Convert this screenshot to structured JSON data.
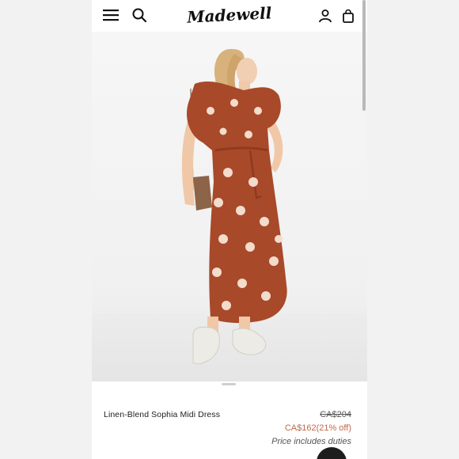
{
  "brand": {
    "logo_text": "Madewell"
  },
  "header": {
    "menu_icon": "hamburger-menu-icon",
    "search_icon": "search-icon",
    "account_icon": "account-icon",
    "bag_icon": "shopping-bag-icon"
  },
  "product": {
    "name": "Linen-Blend Sophia Midi Dress",
    "original_price": "CA$204",
    "sale_price": "CA$162(21% off)",
    "duties_note": "Price includes duties"
  },
  "colors": {
    "dress": "#a8492a",
    "sale_price": "#c0694a",
    "text": "#222222"
  }
}
